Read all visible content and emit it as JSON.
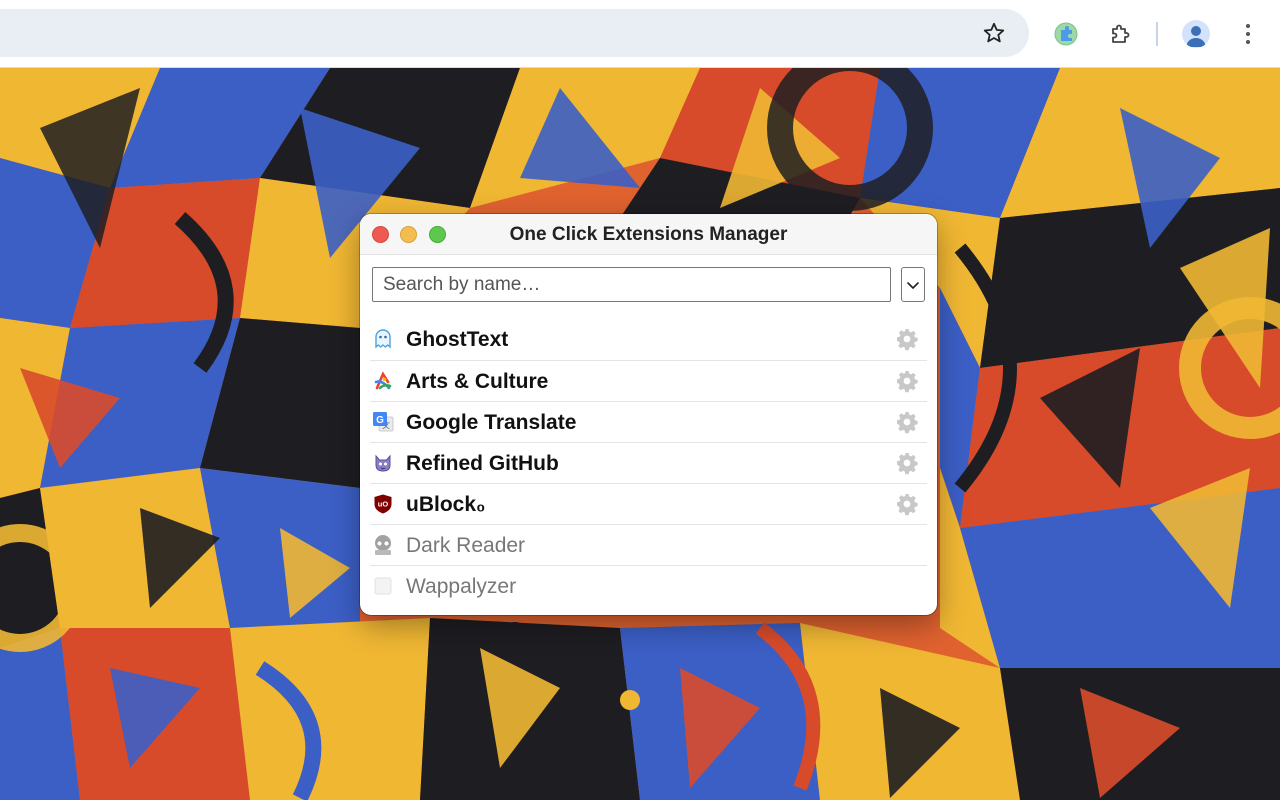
{
  "browser": {
    "icons": {
      "bookmark": "star-outline-icon",
      "extension_active": "green-extension-icon",
      "extensions_menu": "puzzle-icon",
      "profile": "person-avatar-icon",
      "menu": "vertical-dots-icon"
    }
  },
  "popup": {
    "title": "One Click Extensions Manager",
    "search": {
      "placeholder": "Search by name…",
      "value": ""
    },
    "filter": {
      "icon": "chevron-down-icon"
    },
    "extensions": [
      {
        "name": "GhostText",
        "enabled": true,
        "icon": "ghosttext-icon"
      },
      {
        "name": "Arts & Culture",
        "enabled": true,
        "icon": "arts-culture-icon"
      },
      {
        "name": "Google Translate",
        "enabled": true,
        "icon": "google-translate-icon"
      },
      {
        "name": "Refined GitHub",
        "enabled": true,
        "icon": "refined-github-icon"
      },
      {
        "name": "uBlock₀",
        "enabled": true,
        "icon": "ublock-icon"
      },
      {
        "name": "Dark Reader",
        "enabled": false,
        "icon": "dark-reader-icon"
      },
      {
        "name": "Wappalyzer",
        "enabled": false,
        "icon": "wappalyzer-icon"
      }
    ]
  },
  "colors": {
    "traffic_close": "#ee5a52",
    "traffic_minimize": "#f4bd4f",
    "traffic_maximize": "#5ec84e",
    "disabled_text": "#777777",
    "gear": "#c8c8c8"
  }
}
